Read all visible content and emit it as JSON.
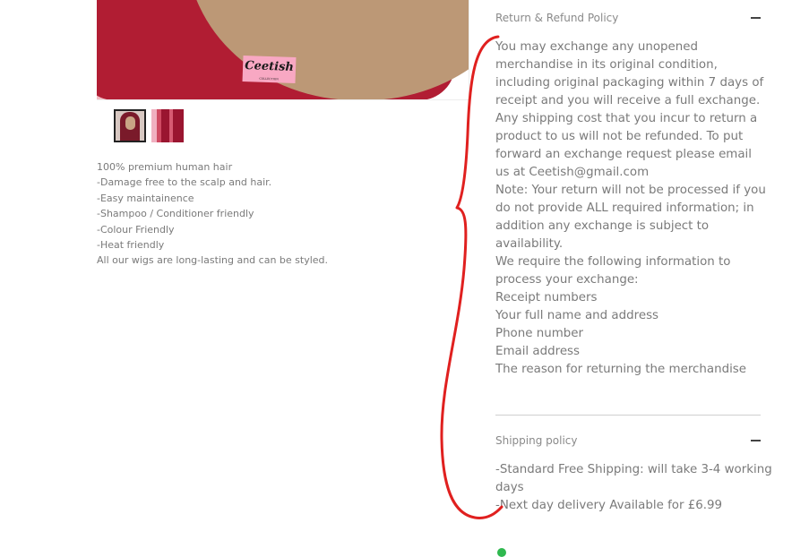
{
  "product": {
    "tag_text": "Ceetish",
    "tag_subtext": "COLLECTION",
    "description_lines": [
      "100% premium human hair",
      "-Damage free to the scalp and hair.",
      "-Easy maintainence",
      "-Shampoo / Conditioner friendly",
      "-Colour Friendly",
      "-Heat friendly",
      "All our wigs are long-lasting and can be styled."
    ]
  },
  "return_policy": {
    "title": "Return & Refund Policy",
    "lines": [
      "You may exchange any unopened",
      "merchandise in its original condition,",
      "including original packaging within 7 days of",
      "receipt and you will receive a full exchange.",
      "Any shipping cost that you incur to return a",
      "product to us will not be refunded. To put",
      "forward an exchange request please email",
      "us at Ceetish@gmail.com",
      "Note: Your return will not be processed if you",
      "do not provide ALL required information; in",
      "addition any exchange is subject to",
      "availability.",
      "We require the following information to",
      "process your exchange:",
      "Receipt numbers",
      "Your full name and address",
      "Phone number",
      "Email address",
      "The reason for returning the merchandise"
    ]
  },
  "shipping_policy": {
    "title": "Shipping policy",
    "lines": [
      "-Standard Free Shipping: will take 3-4 working",
      "days",
      "-Next day delivery Available for £6.99"
    ]
  },
  "colors": {
    "annotation": "#e0201f",
    "text": "#7a7a7a",
    "accent_green": "#2fb84f"
  }
}
